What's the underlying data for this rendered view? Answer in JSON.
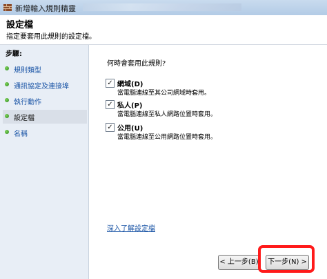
{
  "window": {
    "title": "新增輸入規則精靈"
  },
  "header": {
    "title": "設定檔",
    "subtitle": "指定要套用此規則的設定檔。"
  },
  "steps": {
    "title": "步驟:",
    "items": [
      {
        "label": "規則類型",
        "active": false
      },
      {
        "label": "通訊協定及連接埠",
        "active": false
      },
      {
        "label": "執行動作",
        "active": false
      },
      {
        "label": "設定檔",
        "active": true
      },
      {
        "label": "名稱",
        "active": false
      }
    ]
  },
  "main": {
    "question": "何時會套用此規則?",
    "options": [
      {
        "label": "網域(D)",
        "desc": "當電腦連線至其公司網域時套用。",
        "checked": true
      },
      {
        "label": "私人(P)",
        "desc": "當電腦連線至私人網路位置時套用。",
        "checked": true
      },
      {
        "label": "公用(U)",
        "desc": "當電腦連線至公用網路位置時套用。",
        "checked": true
      }
    ],
    "learn_more": "深入了解設定檔",
    "checkmark": "✓"
  },
  "buttons": {
    "back": "< 上一步(B)",
    "next": "下一步(N) >"
  },
  "colors": {
    "highlight": "#ff1a1a",
    "link": "#1b55a6",
    "step_dot": "#3fa82b"
  }
}
